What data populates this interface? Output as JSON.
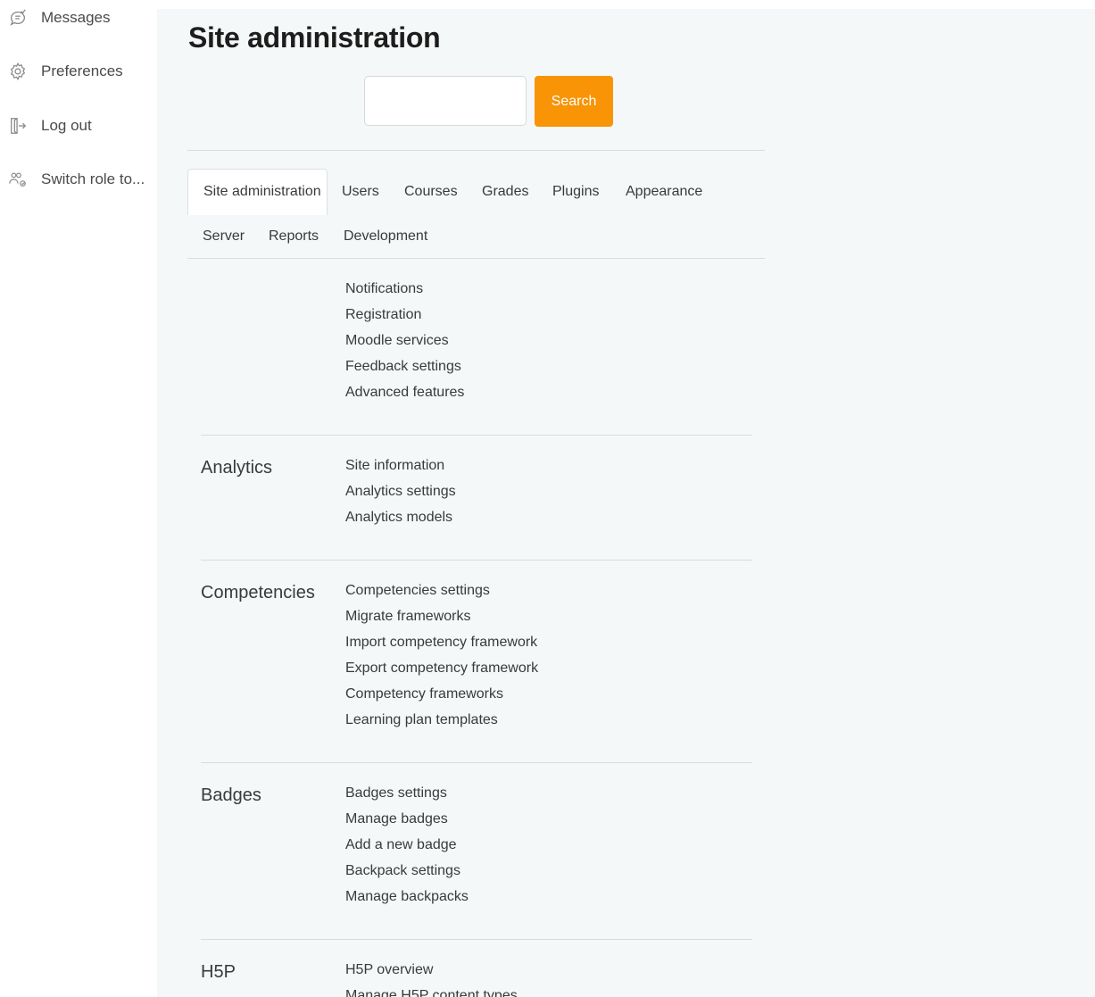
{
  "user_menu": {
    "items": [
      {
        "label": "Messages",
        "icon": "messages-icon"
      },
      {
        "label": "Preferences",
        "icon": "gear-icon"
      },
      {
        "label": "Log out",
        "icon": "logout-icon"
      },
      {
        "label": "Switch role to...",
        "icon": "switch-role-icon"
      }
    ]
  },
  "page": {
    "title": "Site administration"
  },
  "search": {
    "value": "",
    "button_label": "Search"
  },
  "tabs": [
    {
      "label": "Site administration",
      "active": true
    },
    {
      "label": "Users"
    },
    {
      "label": "Courses"
    },
    {
      "label": "Grades"
    },
    {
      "label": "Plugins"
    },
    {
      "label": "Appearance"
    },
    {
      "label": "Server"
    },
    {
      "label": "Reports"
    },
    {
      "label": "Development"
    }
  ],
  "sections": [
    {
      "heading": "",
      "links": [
        "Notifications",
        "Registration",
        "Moodle services",
        "Feedback settings",
        "Advanced features"
      ]
    },
    {
      "heading": "Analytics",
      "links": [
        "Site information",
        "Analytics settings",
        "Analytics models"
      ]
    },
    {
      "heading": "Competencies",
      "links": [
        "Competencies settings",
        "Migrate frameworks",
        "Import competency framework",
        "Export competency framework",
        "Competency frameworks",
        "Learning plan templates"
      ]
    },
    {
      "heading": "Badges",
      "links": [
        "Badges settings",
        "Manage badges",
        "Add a new badge",
        "Backpack settings",
        "Manage backpacks"
      ]
    },
    {
      "heading": "H5P",
      "links": [
        "H5P overview",
        "Manage H5P content types"
      ]
    }
  ],
  "colors": {
    "accent": "#f89406",
    "content_background": "#f4f8f8"
  }
}
